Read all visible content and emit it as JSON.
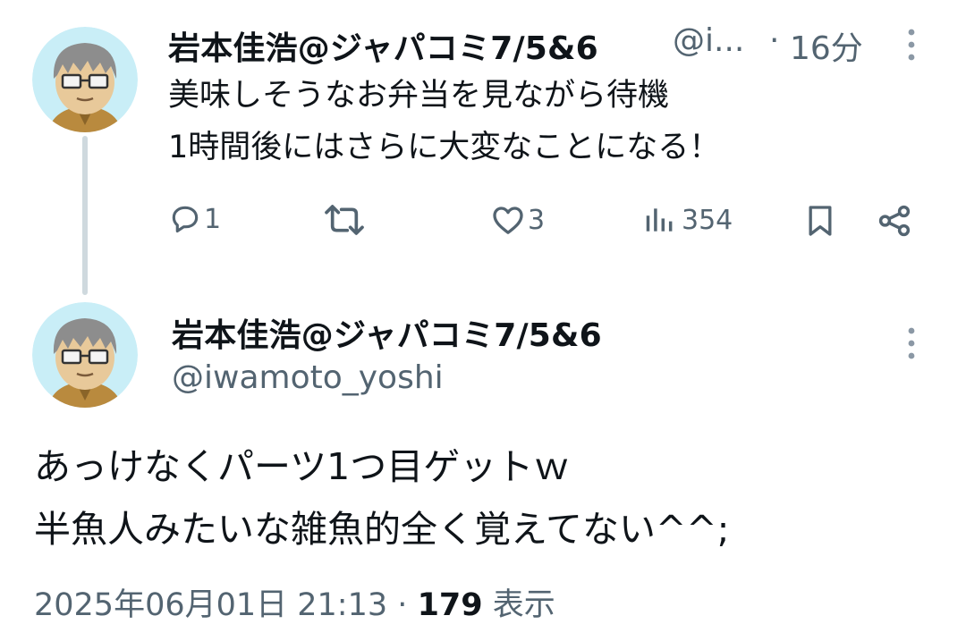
{
  "tweet1": {
    "display_name": "岩本佳浩@ジャパコミ7/5&6",
    "handle_truncated": "@i...",
    "separator": "·",
    "time_ago": "16分",
    "lines": [
      "美味しそうなお弁当を見ながら待機",
      "1時間後にはさらに大変なことになる！"
    ],
    "actions": {
      "reply_count": "1",
      "retweet_count": "",
      "like_count": "3",
      "views_count": "354"
    }
  },
  "tweet2": {
    "display_name": "岩本佳浩@ジャパコミ7/5&6",
    "handle": "@iwamoto_yoshi",
    "lines": [
      "あっけなくパーツ1つ目ゲットｗ",
      "半魚人みたいな雑魚的全く覚えてない^^;"
    ],
    "timestamp": "2025年06月01日 21:13",
    "separator": "·",
    "views_count": "179",
    "views_label": "表示"
  },
  "icons": {
    "reply": "reply-icon",
    "retweet": "retweet-icon",
    "like": "heart-icon",
    "views": "views-icon",
    "bookmark": "bookmark-icon",
    "share": "share-icon",
    "more": "more-vertical-icon"
  },
  "colors": {
    "text": "#0f1419",
    "secondary": "#536471",
    "thread_line": "#cfd9de"
  }
}
